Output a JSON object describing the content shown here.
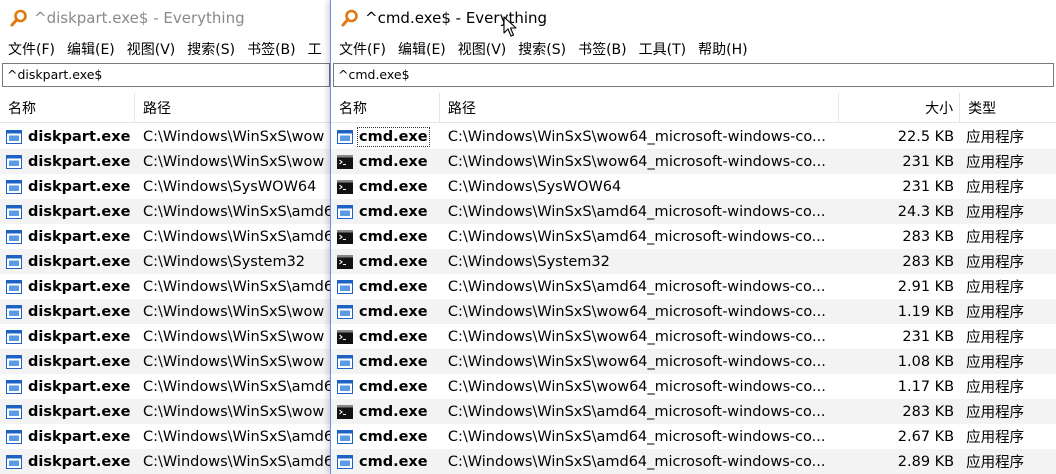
{
  "back_window": {
    "title": "^diskpart.exe$ - Everything",
    "menu": [
      "文件(F)",
      "编辑(E)",
      "视图(V)",
      "搜索(S)",
      "书签(B)",
      "工"
    ],
    "search_value": "^diskpart.exe$",
    "columns": {
      "name": "名称",
      "path": "路径"
    },
    "rows": [
      {
        "name": "diskpart.exe",
        "path": "C:\\Windows\\WinSxS\\wow"
      },
      {
        "name": "diskpart.exe",
        "path": "C:\\Windows\\WinSxS\\wow"
      },
      {
        "name": "diskpart.exe",
        "path": "C:\\Windows\\SysWOW64"
      },
      {
        "name": "diskpart.exe",
        "path": "C:\\Windows\\WinSxS\\amd6"
      },
      {
        "name": "diskpart.exe",
        "path": "C:\\Windows\\WinSxS\\amd6"
      },
      {
        "name": "diskpart.exe",
        "path": "C:\\Windows\\System32"
      },
      {
        "name": "diskpart.exe",
        "path": "C:\\Windows\\WinSxS\\amd6"
      },
      {
        "name": "diskpart.exe",
        "path": "C:\\Windows\\WinSxS\\wow"
      },
      {
        "name": "diskpart.exe",
        "path": "C:\\Windows\\WinSxS\\wow"
      },
      {
        "name": "diskpart.exe",
        "path": "C:\\Windows\\WinSxS\\wow"
      },
      {
        "name": "diskpart.exe",
        "path": "C:\\Windows\\WinSxS\\amd6"
      },
      {
        "name": "diskpart.exe",
        "path": "C:\\Windows\\WinSxS\\wow"
      },
      {
        "name": "diskpart.exe",
        "path": "C:\\Windows\\WinSxS\\amd6"
      },
      {
        "name": "diskpart.exe",
        "path": "C:\\Windows\\WinSxS\\amd6"
      }
    ]
  },
  "front_window": {
    "title": "^cmd.exe$ - Everything",
    "menu": [
      "文件(F)",
      "编辑(E)",
      "视图(V)",
      "搜索(S)",
      "书签(B)",
      "工具(T)",
      "帮助(H)"
    ],
    "search_value": "^cmd.exe$",
    "columns": {
      "name": "名称",
      "path": "路径",
      "size": "大小",
      "type": "类型"
    },
    "rows": [
      {
        "name": "cmd.exe",
        "path": "C:\\Windows\\WinSxS\\wow64_microsoft-windows-co...",
        "size": "22.5 KB",
        "type": "应用程序",
        "icon": "window-app-icon"
      },
      {
        "name": "cmd.exe",
        "path": "C:\\Windows\\WinSxS\\wow64_microsoft-windows-co...",
        "size": "231 KB",
        "type": "应用程序",
        "icon": "console-icon"
      },
      {
        "name": "cmd.exe",
        "path": "C:\\Windows\\SysWOW64",
        "size": "231 KB",
        "type": "应用程序",
        "icon": "console-icon"
      },
      {
        "name": "cmd.exe",
        "path": "C:\\Windows\\WinSxS\\amd64_microsoft-windows-co...",
        "size": "24.3 KB",
        "type": "应用程序",
        "icon": "window-app-icon"
      },
      {
        "name": "cmd.exe",
        "path": "C:\\Windows\\WinSxS\\amd64_microsoft-windows-co...",
        "size": "283 KB",
        "type": "应用程序",
        "icon": "console-icon"
      },
      {
        "name": "cmd.exe",
        "path": "C:\\Windows\\System32",
        "size": "283 KB",
        "type": "应用程序",
        "icon": "console-icon"
      },
      {
        "name": "cmd.exe",
        "path": "C:\\Windows\\WinSxS\\amd64_microsoft-windows-co...",
        "size": "2.91 KB",
        "type": "应用程序",
        "icon": "window-app-icon"
      },
      {
        "name": "cmd.exe",
        "path": "C:\\Windows\\WinSxS\\wow64_microsoft-windows-co...",
        "size": "1.19 KB",
        "type": "应用程序",
        "icon": "window-app-icon"
      },
      {
        "name": "cmd.exe",
        "path": "C:\\Windows\\WinSxS\\wow64_microsoft-windows-co...",
        "size": "231 KB",
        "type": "应用程序",
        "icon": "console-icon"
      },
      {
        "name": "cmd.exe",
        "path": "C:\\Windows\\WinSxS\\wow64_microsoft-windows-co...",
        "size": "1.08 KB",
        "type": "应用程序",
        "icon": "window-app-icon"
      },
      {
        "name": "cmd.exe",
        "path": "C:\\Windows\\WinSxS\\wow64_microsoft-windows-co...",
        "size": "1.17 KB",
        "type": "应用程序",
        "icon": "window-app-icon"
      },
      {
        "name": "cmd.exe",
        "path": "C:\\Windows\\WinSxS\\amd64_microsoft-windows-co...",
        "size": "283 KB",
        "type": "应用程序",
        "icon": "console-icon"
      },
      {
        "name": "cmd.exe",
        "path": "C:\\Windows\\WinSxS\\amd64_microsoft-windows-co...",
        "size": "2.67 KB",
        "type": "应用程序",
        "icon": "window-app-icon"
      },
      {
        "name": "cmd.exe",
        "path": "C:\\Windows\\WinSxS\\amd64_microsoft-windows-co...",
        "size": "2.89 KB",
        "type": "应用程序",
        "icon": "window-app-icon"
      }
    ]
  },
  "colors": {
    "row_alt": "#f3f3f3",
    "app_icon_orange": "#e07a10",
    "exe_icon_blue": "#1e63c4",
    "console_black": "#111111"
  }
}
